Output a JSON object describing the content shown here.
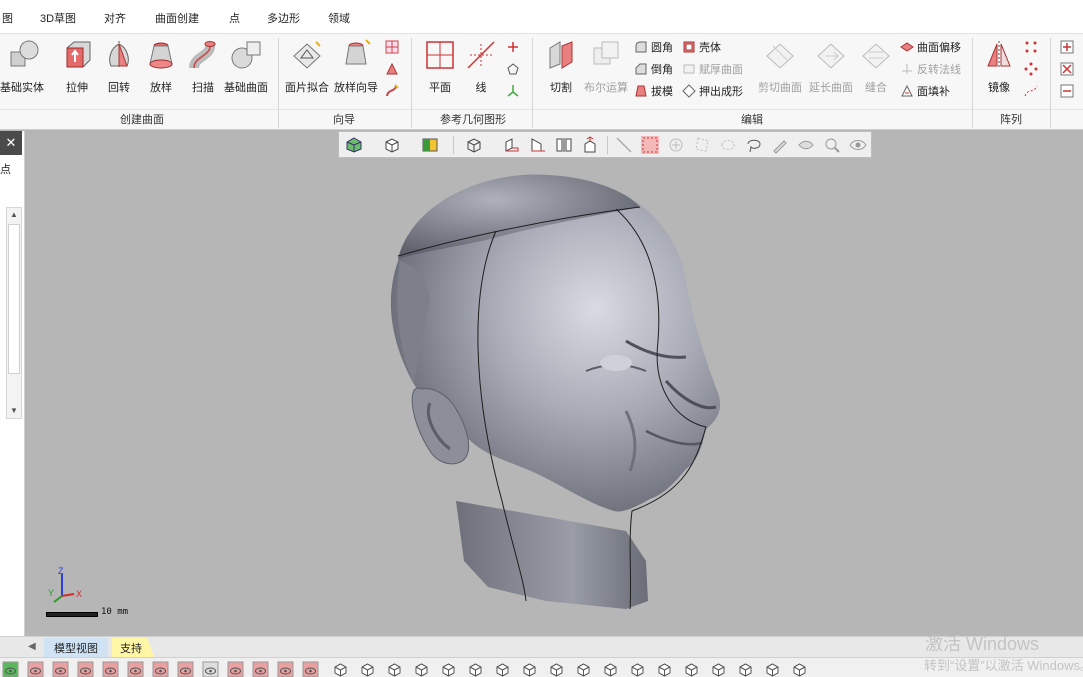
{
  "menu": {
    "tabs": [
      "图",
      "3D草图",
      "对齐",
      "曲面创建",
      "点",
      "多边形",
      "领域"
    ]
  },
  "ribbon": {
    "create_surface": {
      "group_label": "创建曲面",
      "base_solid": "基础实体",
      "extrude": "拉伸",
      "revolve": "回转",
      "loft": "放样",
      "sweep": "扫描",
      "base_surface": "基础曲面"
    },
    "wizard": {
      "group_label": "向导",
      "mesh_fit": "面片拟合",
      "loft_wizard": "放样向导"
    },
    "ref_geometry": {
      "group_label": "参考几何图形",
      "plane": "平面",
      "line": "线"
    },
    "edit": {
      "group_label": "编辑",
      "cut": "切割",
      "boolean": "布尔运算",
      "fillet": "圆角",
      "chamfer": "倒角",
      "draft": "拔模",
      "shell": "壳体",
      "thicken": "赋厚曲面",
      "extrude_shape": "押出成形",
      "trim_surface": "剪切曲面",
      "extend_surface": "延长曲面",
      "stitch": "缝合",
      "offset_surface": "曲面偏移",
      "reverse_normal": "反转法线",
      "fill_face": "面填补"
    },
    "pattern": {
      "group_label": "阵列",
      "mirror": "镜像"
    }
  },
  "left_panel": {
    "close_label": "✕",
    "tab_label": "点"
  },
  "viewport": {
    "scale_label": "10 mm",
    "axes": {
      "z": "Z",
      "y": "Y",
      "x": "X"
    }
  },
  "bottom_tabs": {
    "model_view": "模型视图",
    "support": "支持"
  },
  "watermark": {
    "title": "激活 Windows",
    "subtitle": "转到“设置”以激活 Windows。"
  },
  "colors": {
    "accent_red": "#d93636",
    "ribbon_bg": "#f7f7f7",
    "viewport_bg": "#b6b6b6",
    "support_tab": "#fff7a6",
    "model_tab": "#cfe3f5"
  }
}
